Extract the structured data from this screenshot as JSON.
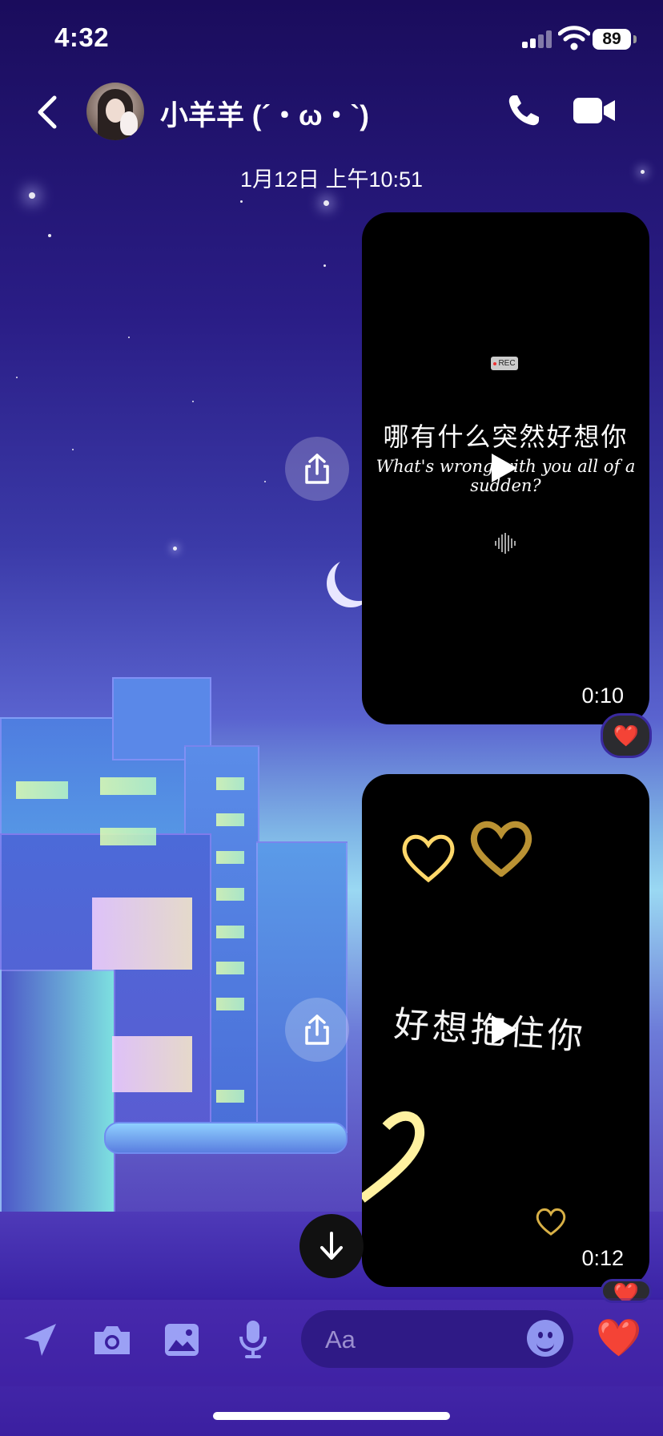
{
  "status_bar": {
    "time": "4:32",
    "battery": "89"
  },
  "header": {
    "contact_name": "小羊羊 (´・ω・`)"
  },
  "timestamp": "1月12日 上午10:51",
  "messages": [
    {
      "rec_label": "REC",
      "text_cn": "哪有什么突然好想你",
      "text_en": "What's wrong with you all of a sudden?",
      "duration": "0:10",
      "reaction": "❤️"
    },
    {
      "text_cn": "好想抱住你",
      "duration": "0:12",
      "reaction": "❤️"
    }
  ],
  "composer": {
    "placeholder": "Aa",
    "like": "❤️"
  },
  "icons": [
    "back-icon",
    "phone-icon",
    "video-camera-icon",
    "share-icon",
    "play-icon",
    "arrow-down-icon",
    "send-location-icon",
    "camera-icon",
    "image-icon",
    "microphone-icon",
    "emoji-icon",
    "heart-icon"
  ]
}
